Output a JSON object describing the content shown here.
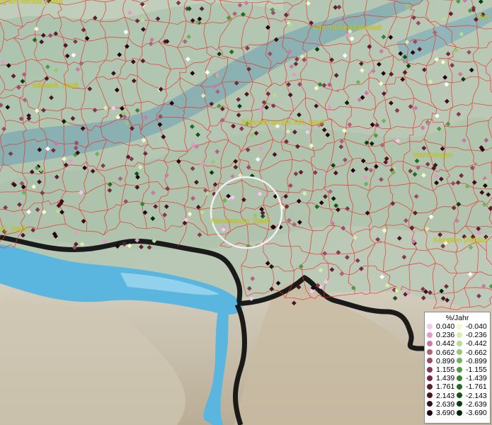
{
  "map": {
    "cities": [
      {
        "name": "rg am Neckar, Stadt"
      },
      {
        "name": "Ulm, Universitätsstadt"
      },
      {
        "name": "Albstadt, Stadt"
      },
      {
        "name": "Biberach an der Riß, Stadt"
      },
      {
        "name": "Memmingen"
      },
      {
        "name": "Ravensburg, Stadt"
      },
      {
        "name": "Kempten (Allgäu)"
      },
      {
        "name": "e), Stadt"
      },
      {
        "name": "Bur"
      }
    ],
    "colors": {
      "boundary": "#e8372f",
      "border_country": "#111111",
      "lake": "#5ab6df",
      "city_label": "#d6d400",
      "highlight_ring": "#f0f0f0"
    }
  },
  "legend": {
    "title": "%/Jahr",
    "positive": [
      {
        "label": "0.040",
        "color": "#f7c8ef"
      },
      {
        "label": "0.236",
        "color": "#e49ac9"
      },
      {
        "label": "0.442",
        "color": "#c97ba3"
      },
      {
        "label": "0.662",
        "color": "#b0627d"
      },
      {
        "label": "0.899",
        "color": "#9a4c64"
      },
      {
        "label": "1.155",
        "color": "#84394f"
      },
      {
        "label": "1.439",
        "color": "#722a3c"
      },
      {
        "label": "1.761",
        "color": "#5f1e2d"
      },
      {
        "label": "2.143",
        "color": "#4b1420"
      },
      {
        "label": "2.639",
        "color": "#3a0c16"
      },
      {
        "label": "3.690",
        "color": "#24040b"
      }
    ],
    "negative": [
      {
        "label": "-0.040",
        "color": "#f3f8c9"
      },
      {
        "label": "-0.236",
        "color": "#d7ecb0"
      },
      {
        "label": "-0.442",
        "color": "#b7dd91"
      },
      {
        "label": "-0.662",
        "color": "#95c86f"
      },
      {
        "label": "-0.899",
        "color": "#72b25a"
      },
      {
        "label": "-1.155",
        "color": "#4f9a40"
      },
      {
        "label": "-1.439",
        "color": "#38832f"
      },
      {
        "label": "-1.761",
        "color": "#236b22"
      },
      {
        "label": "-2.143",
        "color": "#135418"
      },
      {
        "label": "-2.639",
        "color": "#0a3f0e"
      },
      {
        "label": "-3.690",
        "color": "#032806"
      }
    ]
  }
}
